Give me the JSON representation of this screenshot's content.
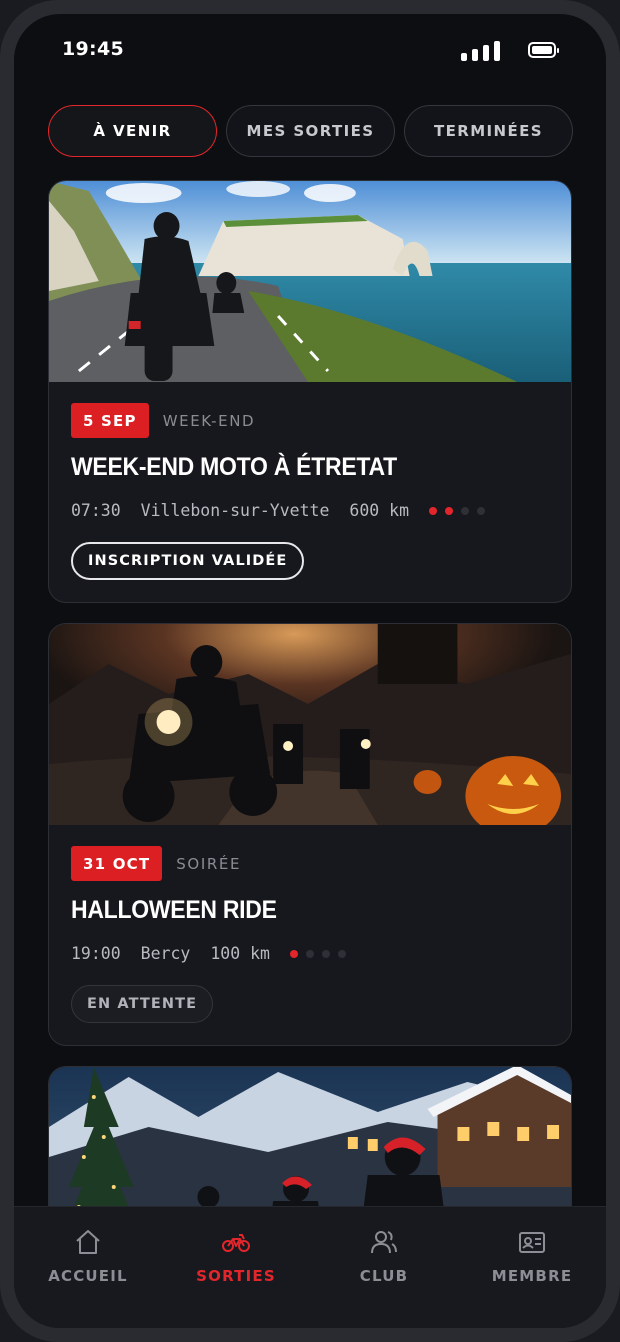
{
  "status_bar": {
    "time": "19:45"
  },
  "tabs": [
    {
      "label": "À VENIR",
      "active": true
    },
    {
      "label": "MES SORTIES",
      "active": false
    },
    {
      "label": "TERMINÉES",
      "active": false
    }
  ],
  "events": [
    {
      "image": "motorcycle-coastal-cliffs",
      "date": "5 SEP",
      "category": "WEEK-END",
      "title": "WEEK-END MOTO À ÉTRETAT",
      "time": "07:30",
      "location": "Villebon-sur-Yvette",
      "distance": "600 km",
      "difficulty": 2,
      "difficulty_max": 4,
      "status": "INSCRIPTION VALIDÉE"
    },
    {
      "image": "halloween-night-ride",
      "date": "31 OCT",
      "category": "SOIRÉE",
      "title": "HALLOWEEN RIDE",
      "time": "19:00",
      "location": "Bercy",
      "distance": "100 km",
      "difficulty": 1,
      "difficulty_max": 4,
      "status": "EN ATTENTE"
    },
    {
      "image": "christmas-village-ride"
    }
  ],
  "bottom_nav": [
    {
      "label": "ACCUEIL",
      "icon": "home-icon",
      "active": false
    },
    {
      "label": "SORTIES",
      "icon": "motorcycle-icon",
      "active": true
    },
    {
      "label": "CLUB",
      "icon": "users-icon",
      "active": false
    },
    {
      "label": "MEMBRE",
      "icon": "id-card-icon",
      "active": false
    }
  ],
  "colors": {
    "accent": "#e3262b",
    "background": "#0d0e12",
    "card": "#17181d"
  }
}
